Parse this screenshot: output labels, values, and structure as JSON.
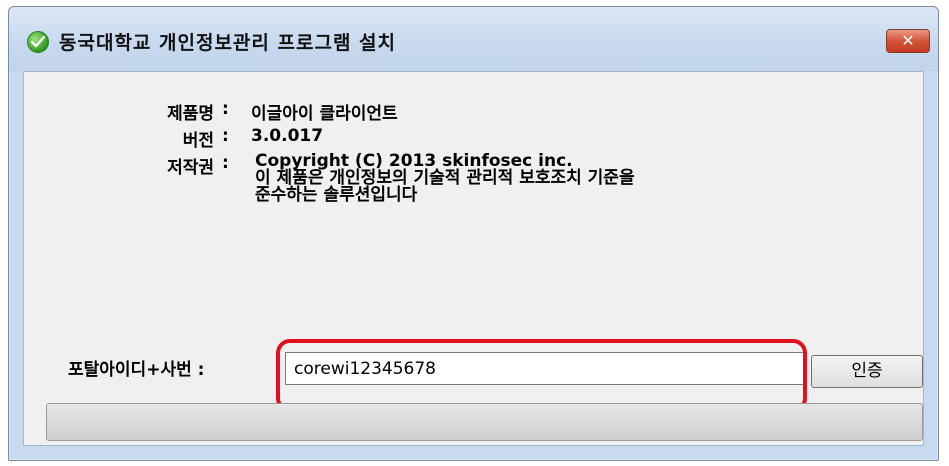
{
  "window": {
    "title": "동국대학교 개인정보관리 프로그램 설치",
    "close_label": "✕"
  },
  "info": {
    "product_label": "제품명",
    "product_value": "이글아이 클라이언트",
    "version_label": "버전",
    "version_value": "3.0.017",
    "copyright_label": "저작권",
    "copyright_line1": "Copyright (C) 2013 skinfosec inc.",
    "copyright_line2": "이 제품은 개인정보의 기술적 관리적 보호조치 기준을",
    "copyright_line3": "준수하는 솔루션입니다",
    "colon": ":"
  },
  "auth": {
    "label": "포탈아이디+사번 :",
    "input_value": "corewi12345678",
    "button_label": "인증"
  },
  "progress": {
    "value": 0
  }
}
